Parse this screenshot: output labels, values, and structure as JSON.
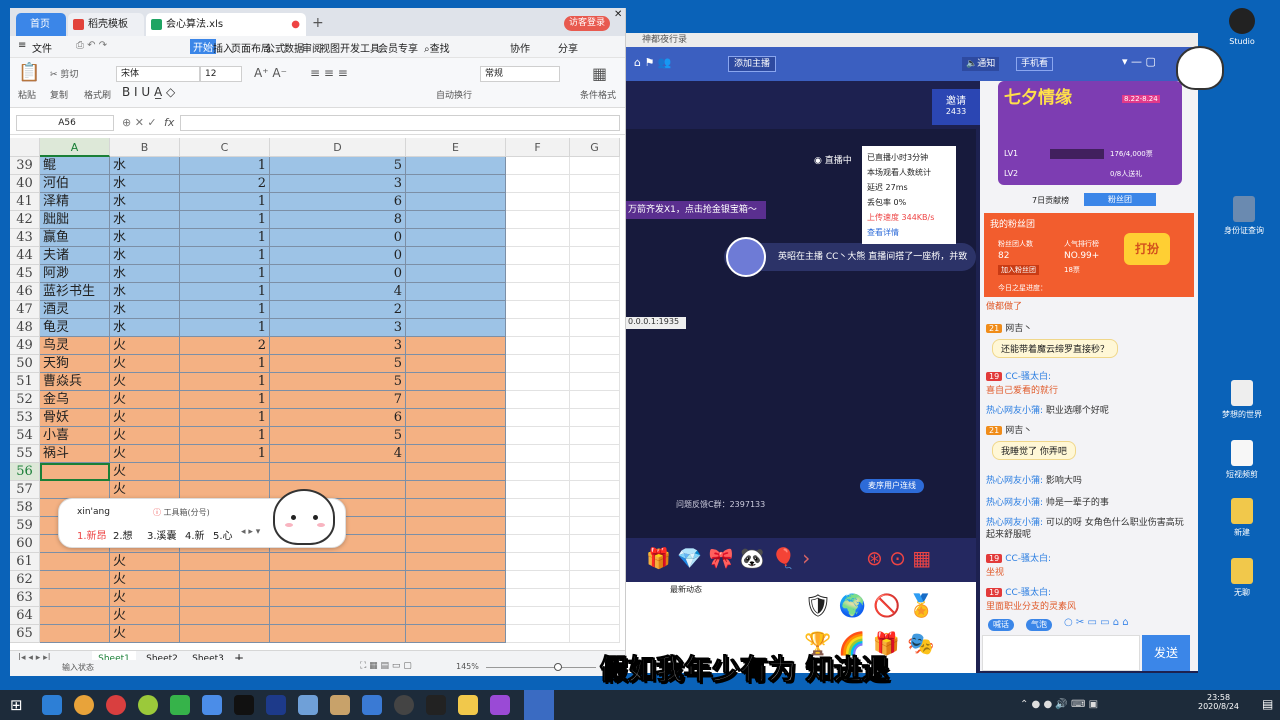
{
  "spreadsheet": {
    "tabs": [
      {
        "label": "首页"
      },
      {
        "label": "稻壳模板"
      },
      {
        "label": "会心算法.xls"
      }
    ],
    "login_label": "访客登录",
    "menu": {
      "file": "文件",
      "items": [
        "开始",
        "插入",
        "页面布局",
        "公式",
        "数据",
        "审阅",
        "视图",
        "开发工具",
        "会员专享"
      ],
      "search": "查找",
      "collab": "协作",
      "share": "分享"
    },
    "ribbon": {
      "cut": "剪切",
      "paste": "粘贴",
      "copy": "复制",
      "format_painter": "格式刷",
      "font_name": "宋体",
      "font_size": "12",
      "number_format": "常规",
      "autowrap": "自动换行",
      "cond_format": "条件格式"
    },
    "namebox": "A56",
    "fx": "fx",
    "columns": [
      "A",
      "B",
      "C",
      "D",
      "E",
      "F",
      "G"
    ],
    "rows": [
      {
        "n": "39",
        "a": "鲲",
        "b": "水",
        "c": "1",
        "d": "5",
        "fill": "blue"
      },
      {
        "n": "40",
        "a": "河伯",
        "b": "水",
        "c": "2",
        "d": "3",
        "fill": "blue"
      },
      {
        "n": "41",
        "a": "泽精",
        "b": "水",
        "c": "1",
        "d": "6",
        "fill": "blue"
      },
      {
        "n": "42",
        "a": "胐胐",
        "b": "水",
        "c": "1",
        "d": "8",
        "fill": "blue"
      },
      {
        "n": "43",
        "a": "赢鱼",
        "b": "水",
        "c": "1",
        "d": "0",
        "fill": "blue"
      },
      {
        "n": "44",
        "a": "夫诸",
        "b": "水",
        "c": "1",
        "d": "0",
        "fill": "blue"
      },
      {
        "n": "45",
        "a": "阿渺",
        "b": "水",
        "c": "1",
        "d": "0",
        "fill": "blue"
      },
      {
        "n": "46",
        "a": "蓝衫书生",
        "b": "水",
        "c": "1",
        "d": "4",
        "fill": "blue"
      },
      {
        "n": "47",
        "a": "酒灵",
        "b": "水",
        "c": "1",
        "d": "2",
        "fill": "blue"
      },
      {
        "n": "48",
        "a": "龟灵",
        "b": "水",
        "c": "1",
        "d": "3",
        "fill": "blue"
      },
      {
        "n": "49",
        "a": "鸟灵",
        "b": "火",
        "c": "2",
        "d": "3",
        "fill": "orange"
      },
      {
        "n": "50",
        "a": "天狗",
        "b": "火",
        "c": "1",
        "d": "5",
        "fill": "orange"
      },
      {
        "n": "51",
        "a": "曹焱兵",
        "b": "火",
        "c": "1",
        "d": "5",
        "fill": "orange"
      },
      {
        "n": "52",
        "a": "金乌",
        "b": "火",
        "c": "1",
        "d": "7",
        "fill": "orange"
      },
      {
        "n": "53",
        "a": "骨妖",
        "b": "火",
        "c": "1",
        "d": "6",
        "fill": "orange"
      },
      {
        "n": "54",
        "a": "小喜",
        "b": "火",
        "c": "1",
        "d": "5",
        "fill": "orange"
      },
      {
        "n": "55",
        "a": "祸斗",
        "b": "火",
        "c": "1",
        "d": "4",
        "fill": "orange"
      },
      {
        "n": "56",
        "a": "",
        "b": "火",
        "c": "",
        "d": "",
        "fill": "orange"
      },
      {
        "n": "57",
        "a": "",
        "b": "火",
        "c": "",
        "d": "",
        "fill": "orange"
      },
      {
        "n": "58",
        "a": "",
        "b": "火",
        "c": "",
        "d": "",
        "fill": "orange"
      },
      {
        "n": "59",
        "a": "",
        "b": "火",
        "c": "",
        "d": "",
        "fill": "orange"
      },
      {
        "n": "60",
        "a": "",
        "b": "火",
        "c": "",
        "d": "",
        "fill": "orange"
      },
      {
        "n": "61",
        "a": "",
        "b": "火",
        "c": "",
        "d": "",
        "fill": "orange"
      },
      {
        "n": "62",
        "a": "",
        "b": "火",
        "c": "",
        "d": "",
        "fill": "orange"
      },
      {
        "n": "63",
        "a": "",
        "b": "火",
        "c": "",
        "d": "",
        "fill": "orange"
      },
      {
        "n": "64",
        "a": "",
        "b": "火",
        "c": "",
        "d": "",
        "fill": "orange"
      },
      {
        "n": "65",
        "a": "",
        "b": "火",
        "c": "",
        "d": "",
        "fill": "orange"
      }
    ],
    "sheets": [
      "Sheet1",
      "Sheet2",
      "Sheet3"
    ],
    "status_mode": "输入状态",
    "zoom": "145%",
    "ime": {
      "pinyin": "xin'ang",
      "toolbox": "工具箱(分号)",
      "candidates": [
        "1.新昂",
        "2.想",
        "3.溪囊",
        "4.新",
        "5.心"
      ]
    }
  },
  "stream_app": {
    "title": "神都夜行录",
    "start_live": "添加主播",
    "notify": "通知",
    "phone_label": "手机看",
    "invite": "邀请",
    "invite_count": "2433",
    "live_label": "直播中",
    "stats": [
      "已直播小时3分钟",
      "本场观看人数统计",
      "延迟   27ms",
      "丢包率   0%",
      "上传速度  344KB/s",
      "查看详情"
    ],
    "banner": "万箭齐发X1，点击抢金银宝箱～",
    "gift_notice": "英昭在主播 CC丶大熊 直播间搭了一座桥，并致",
    "ip": "0.0.0.1:1935",
    "feedback": "问题反馈C群：2397133",
    "link_label": "麦序用户连线",
    "event": {
      "title": "七夕情缘",
      "dates": "8.22-8.24",
      "lv1": "LV1",
      "lv1_progress": "176/4,000票",
      "lv2": "LV2",
      "lv2_progress": "0/8人送礼"
    },
    "chat_tabs": [
      "7日贡献榜",
      "粉丝团"
    ],
    "fan_club": {
      "title": "我的粉丝团",
      "fans_label": "粉丝团人数",
      "fans": "82",
      "rank_label": "人气排行榜",
      "rank": "NO.99+",
      "join": "加入粉丝团",
      "members": "18票",
      "action": "打扮",
      "today": "今日之星进度："
    },
    "messages": [
      {
        "user": "",
        "text": "做都做了"
      },
      {
        "user": "网吉丶",
        "text": "还能带着魔云缔罗直接秒？"
      },
      {
        "user": "CC-骚太白:",
        "text": "喜自己爱看的就行"
      },
      {
        "user": "热心网友小蒲:",
        "text": "职业选哪个好呢"
      },
      {
        "user": "网吉丶",
        "text": "我睡觉了 你弄吧"
      },
      {
        "user": "热心网友小蒲:",
        "text": "影响大吗"
      },
      {
        "user": "热心网友小蒲:",
        "text": "帅是一辈子的事"
      },
      {
        "user": "热心网友小蒲:",
        "text": "可以的呀 女角色什么职业伤害高玩起来舒服呢"
      },
      {
        "user": "CC-骚太白:",
        "text": "坐视"
      },
      {
        "user": "CC-骚太白:",
        "text": "里面职业分支的灵素风"
      }
    ],
    "send": "发送",
    "chat_buttons": [
      "喊话",
      "气泡"
    ],
    "news": "最新动态"
  },
  "desktop": {
    "icons": [
      {
        "label": "Studio"
      },
      {
        "label": "身份证查询"
      },
      {
        "label": "梦想的世界"
      },
      {
        "label": "短视频剪"
      },
      {
        "label": "新建"
      },
      {
        "label": "无聊"
      }
    ],
    "subtitle": "假如我年少有为 知进退",
    "clock_time": "23:58",
    "clock_date": "2020/8/24"
  }
}
